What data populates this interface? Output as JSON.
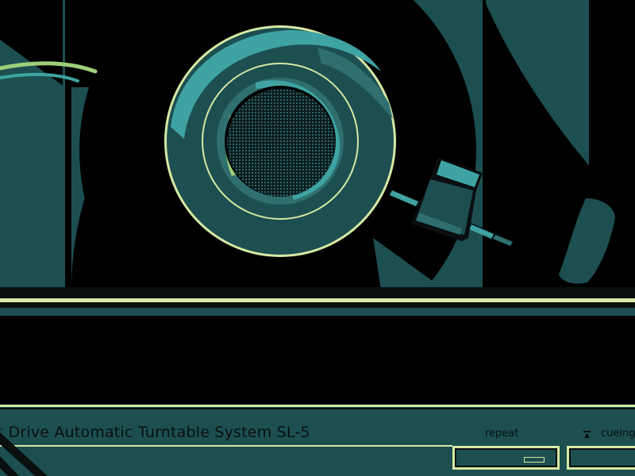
{
  "panel": {
    "model_text": "ct Drive Automatic Turntable System  SL-5"
  },
  "buttons": {
    "repeat_label": "repeat",
    "cueing_label": "cueing"
  },
  "colors": {
    "background": "#000000",
    "teal_dark": "#1d4f51",
    "teal_mid": "#2f6f70",
    "teal_light": "#3fa3a3",
    "cream": "#d6e8a4",
    "green_accent": "#9fce7a"
  },
  "icons": {
    "cueing": "lift-arrow-icon"
  }
}
